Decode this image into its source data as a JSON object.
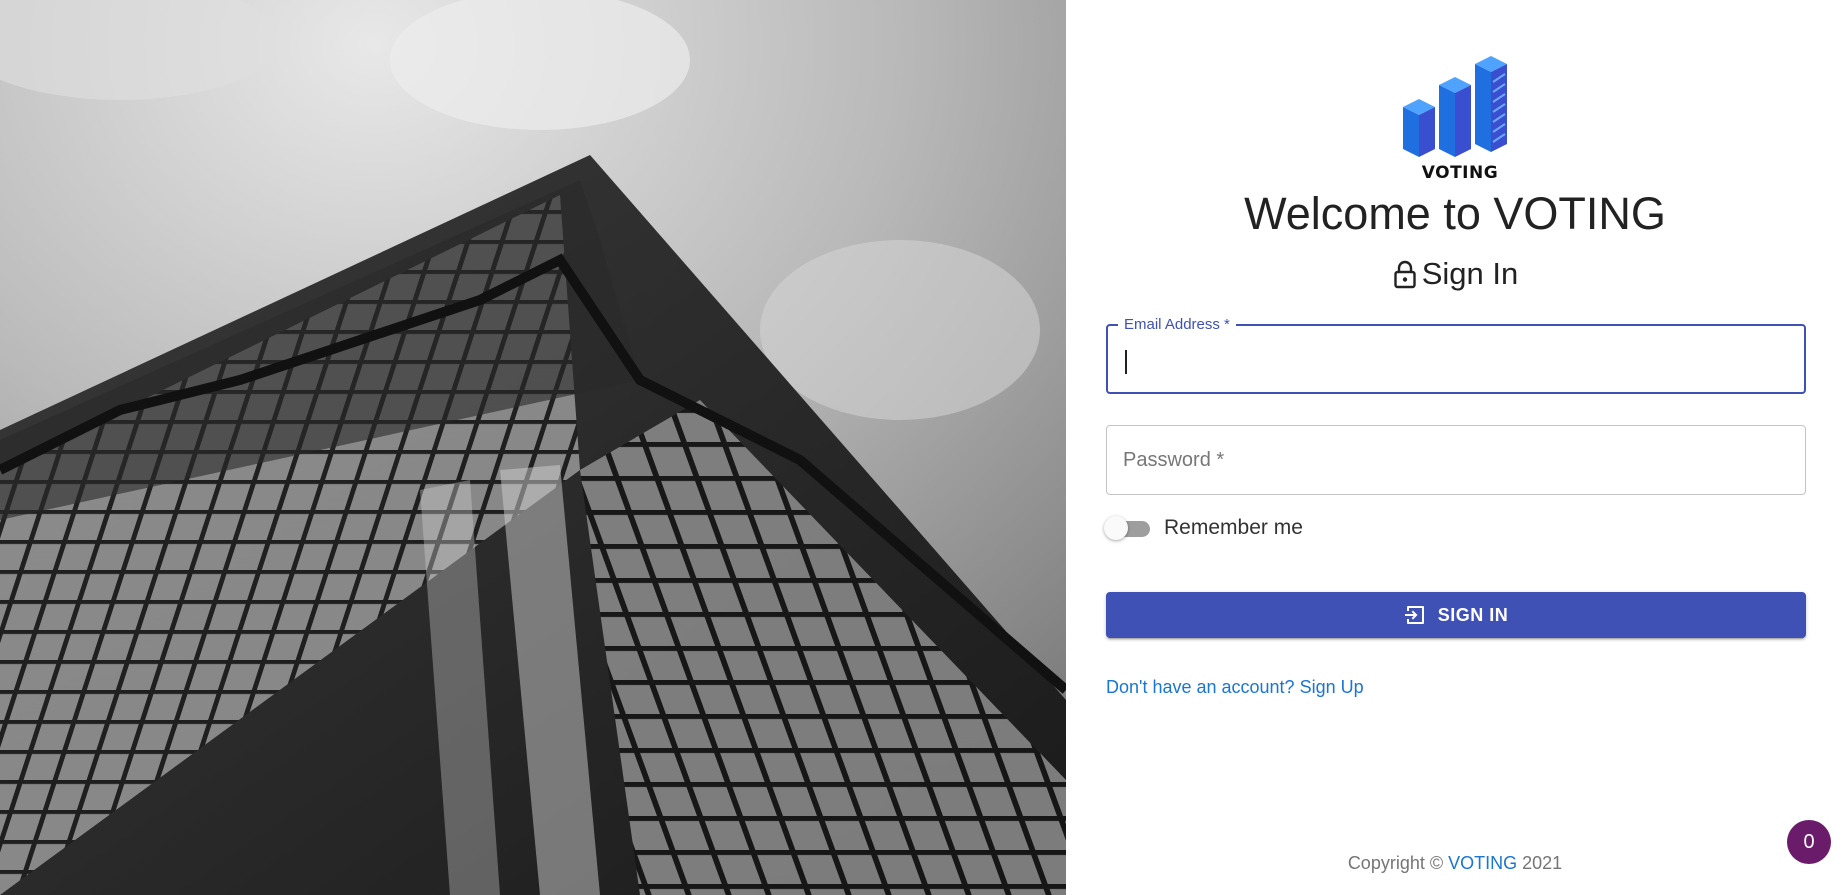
{
  "hero": {
    "description_icon": "skyscraper-photo"
  },
  "brand": {
    "logo_text": "VOTING",
    "accent": "#3f51b5",
    "link": "#1976d2"
  },
  "welcome_title": "Welcome to VOTING",
  "signin": {
    "icon": "lock-icon",
    "title": "Sign In"
  },
  "form": {
    "email_label": "Email Address *",
    "email_value": "",
    "password_placeholder": "Password *",
    "password_value": "",
    "remember_label": "Remember me",
    "remember_checked": false,
    "submit_label": "SIGN IN",
    "submit_icon": "login-icon"
  },
  "signup_link": "Don't have an account? Sign Up",
  "footer": {
    "prefix": "Copyright © ",
    "brand": "VOTING",
    "year": " 2021"
  },
  "badge": {
    "count": "0",
    "color": "#6a1b6a"
  }
}
